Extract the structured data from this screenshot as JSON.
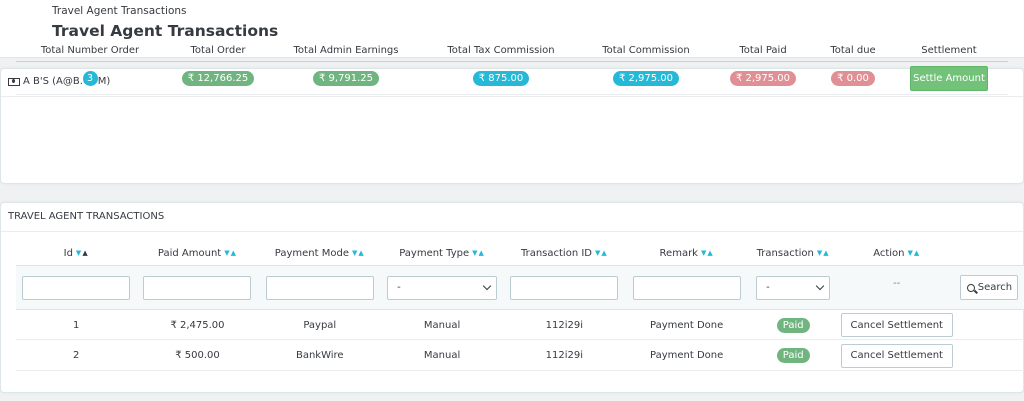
{
  "header": {
    "breadcrumb": "Travel Agent Transactions",
    "title": "Travel Agent Transactions"
  },
  "summary": {
    "heading": "A B'S (A@B.COM)",
    "columns": [
      "Total Number Order",
      "Total Order",
      "Total Admin Earnings",
      "Total Tax Commission",
      "Total Commission",
      "Total Paid",
      "Total due",
      "Settlement"
    ],
    "values": {
      "number_order": "3",
      "total_order": "₹ 12,766.25",
      "admin_earnings": "₹ 9,791.25",
      "tax_commission": "₹ 875.00",
      "commission": "₹ 2,975.00",
      "paid": "₹ 2,975.00",
      "due": "₹ 0.00"
    },
    "settle_label": "Settle Amount"
  },
  "transactions": {
    "heading": "TRAVEL AGENT TRANSACTIONS",
    "columns": [
      "Id",
      "Paid Amount",
      "Payment Mode",
      "Payment Type",
      "Transaction ID",
      "Remark",
      "Transaction",
      "Action"
    ],
    "filters": {
      "payment_type_value": "-",
      "transaction_value": "-",
      "action_placeholder": "--",
      "search_label": "Search"
    },
    "rows": [
      {
        "id": "1",
        "paid_amount": "₹ 2,475.00",
        "mode": "Paypal",
        "type": "Manual",
        "transaction_id": "112i29i",
        "remark": "Payment Done",
        "status": "Paid",
        "action": "Cancel Settlement"
      },
      {
        "id": "2",
        "paid_amount": "₹ 500.00",
        "mode": "BankWire",
        "type": "Manual",
        "transaction_id": "112i29i",
        "remark": "Payment Done",
        "status": "Paid",
        "action": "Cancel Settlement"
      }
    ]
  },
  "colors": {
    "info": "#25b9d7",
    "success": "#70b580",
    "danger": "#e08f95",
    "button_success": "#72c279"
  }
}
